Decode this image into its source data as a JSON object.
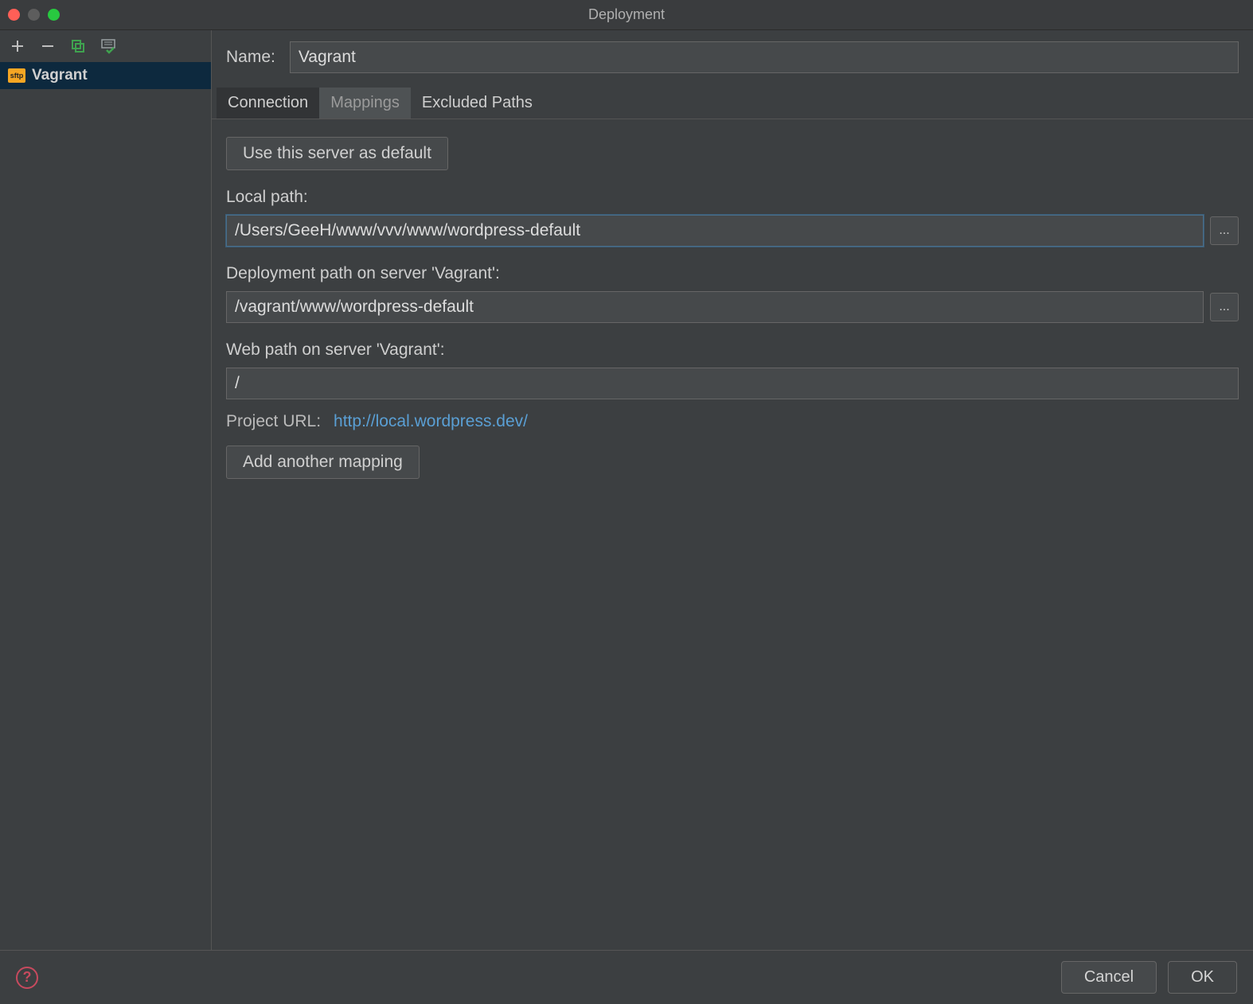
{
  "window": {
    "title": "Deployment"
  },
  "sidebar": {
    "servers": [
      {
        "label": "Vagrant",
        "icon": "sftp"
      }
    ]
  },
  "main": {
    "nameLabel": "Name:",
    "nameValue": "Vagrant",
    "tabs": [
      {
        "label": "Connection"
      },
      {
        "label": "Mappings"
      },
      {
        "label": "Excluded Paths"
      }
    ],
    "activeTab": 1,
    "defaultButton": "Use this server as default",
    "localPathLabel": "Local path:",
    "localPathValue": "/Users/GeeH/www/vvv/www/wordpress-default",
    "deployPathLabel": "Deployment path on server 'Vagrant':",
    "deployPathValue": "/vagrant/www/wordpress-default",
    "webPathLabel": "Web path on server 'Vagrant':",
    "webPathValue": "/",
    "projectUrlLabel": "Project URL:",
    "projectUrlValue": "http://local.wordpress.dev/",
    "addMappingButton": "Add another mapping",
    "browseDots": "..."
  },
  "footer": {
    "cancel": "Cancel",
    "ok": "OK"
  }
}
